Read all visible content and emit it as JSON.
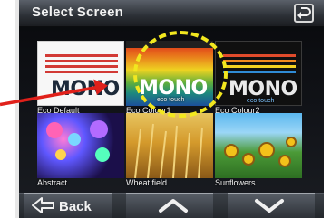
{
  "screen": {
    "title": "Select Screen",
    "tiles": [
      {
        "label": "Eco Default",
        "mono": "MONO"
      },
      {
        "label": "Eco Colour1",
        "mono": "MONO",
        "sub": "eco touch"
      },
      {
        "label": "Eco Colour2",
        "mono": "MONO",
        "sub": "eco touch"
      },
      {
        "label": "Abstract"
      },
      {
        "label": "Wheat field"
      },
      {
        "label": "Sunflowers"
      }
    ],
    "bottom": {
      "back_label": "Back"
    }
  },
  "colors": {
    "highlight": "#f2e71f",
    "arrow": "#e0201a"
  }
}
